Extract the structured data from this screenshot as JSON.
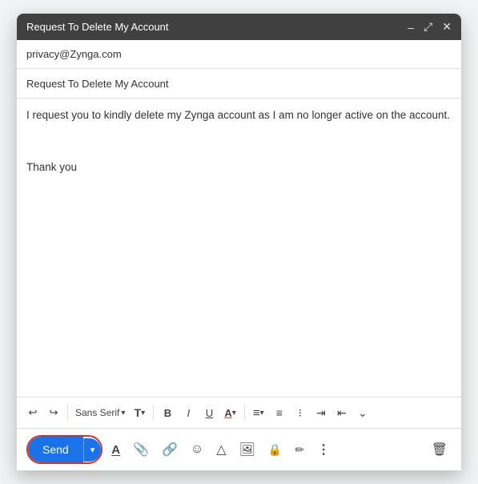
{
  "window": {
    "title": "Request To Delete My Account",
    "controls": {
      "minimize": "–",
      "maximize": "⤢",
      "close": "✕"
    }
  },
  "fields": {
    "to": "privacy@Zynga.com",
    "subject": "Request To Delete My Account"
  },
  "body": {
    "line1": "I request you to kindly delete my Zynga account as I am no longer active on the account.",
    "line2": "",
    "line3": "Thank you"
  },
  "toolbar": {
    "undo": "↩",
    "redo": "↪",
    "font_family": "Sans Serif",
    "font_size_icon": "T",
    "bold": "B",
    "italic": "I",
    "underline": "U",
    "font_color": "A",
    "align": "≡",
    "ol": "≔",
    "ul": "≔",
    "indent": "⇥",
    "outdent": "⇤",
    "more": "⌄"
  },
  "actions": {
    "send_label": "Send",
    "send_dropdown": "▾",
    "formatting_icon": "A",
    "attachment_icon": "📎",
    "link_icon": "🔗",
    "emoji_icon": "☺",
    "drive_icon": "△",
    "photo_icon": "🖼",
    "lock_icon": "🔒",
    "pen_icon": "✏",
    "more_icon": "⋮",
    "delete_icon": "🗑"
  }
}
